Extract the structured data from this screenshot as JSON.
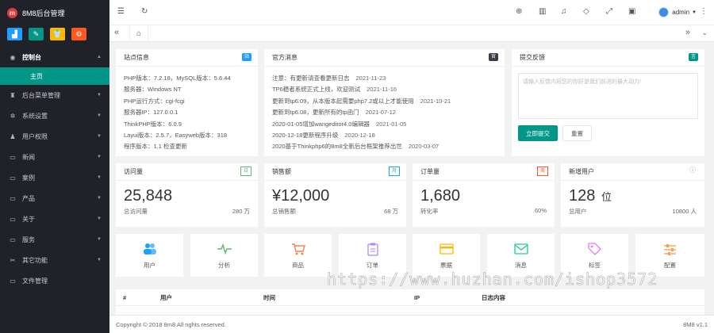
{
  "app": {
    "title": "8M8后台管理",
    "logo_letter": "m"
  },
  "quick_buttons": [
    {
      "icon": "chart-icon",
      "color": "#1e9fff",
      "glyph": "▟"
    },
    {
      "icon": "edit-icon",
      "color": "#009688",
      "glyph": "✎"
    },
    {
      "icon": "tshirt-icon",
      "color": "#ffb800",
      "glyph": "👕"
    },
    {
      "icon": "settings-icon",
      "color": "#ff5722",
      "glyph": "⚙"
    }
  ],
  "sidebar": {
    "items": [
      {
        "label": "控制台",
        "icon": "dashboard-icon",
        "glyph": "◉",
        "caret": "▲"
      },
      {
        "label": "后台菜单管理",
        "icon": "menu-icon",
        "glyph": "♜",
        "caret": "▼"
      },
      {
        "label": "系统设置",
        "icon": "gear-icon",
        "glyph": "✲",
        "caret": "▼"
      },
      {
        "label": "用户权限",
        "icon": "users-icon",
        "glyph": "♟",
        "caret": "▼"
      },
      {
        "label": "新闻",
        "icon": "monitor-icon",
        "glyph": "▭",
        "caret": "▼"
      },
      {
        "label": "案例",
        "icon": "monitor-icon",
        "glyph": "▭",
        "caret": "▼"
      },
      {
        "label": "产品",
        "icon": "monitor-icon",
        "glyph": "▭",
        "caret": "▼"
      },
      {
        "label": "关于",
        "icon": "monitor-icon",
        "glyph": "▭",
        "caret": "▼"
      },
      {
        "label": "服务",
        "icon": "monitor-icon",
        "glyph": "▭",
        "caret": "▼"
      },
      {
        "label": "其它功能",
        "icon": "wrench-icon",
        "glyph": "✂",
        "caret": "▼"
      },
      {
        "label": "文件管理",
        "icon": "monitor-icon",
        "glyph": "▭",
        "caret": ""
      }
    ],
    "active_sub": "主页"
  },
  "topbar": {
    "user": "admin",
    "icons": [
      "collapse-icon",
      "refresh-icon",
      "globe-icon",
      "trash-icon",
      "bell-icon",
      "tag-icon",
      "fullscreen-icon",
      "lock-icon",
      "more-icon"
    ]
  },
  "tabs": {
    "home_glyph": "⌂"
  },
  "site_info": {
    "title": "站点信息",
    "tag": "站",
    "tag_color": "#1e9fff",
    "lines": [
      "PHP版本：7.2.18，MySQL版本：5.6.44",
      "服务器：Windows NT",
      "PHP运行方式：cgi-fcgi",
      "服务器IP：127.0.0.1",
      "ThinkPHP版本：6.0.9",
      "Layui版本：2.5.7，Easyweb版本：318",
      "程序版本：1.1 检查更新"
    ]
  },
  "official_news": {
    "title": "官方消息",
    "tag": "官",
    "tag_color": "#393d49",
    "items": [
      {
        "text": "注意：有更新请查看更新日志",
        "date": "2021-11-23"
      },
      {
        "text": "TP6稳者系统正式上线，欢迎测试",
        "date": "2021-11-16"
      },
      {
        "text": "更新到tp6.09，从本版本起需要php7.2或以上才能使用",
        "date": "2021-10-21"
      },
      {
        "text": "更新到tp6.08，更新所有的tp函门",
        "date": "2021-07-12"
      },
      {
        "text": "2020-01-05增加wangeditor4.0编辑器",
        "date": "2021-01-05"
      },
      {
        "text": "2020-12-18更新程序升级",
        "date": "2020-12-18"
      },
      {
        "text": "2020基于Thinkphp6的8m8全新后台框架推荐出世",
        "date": "2020-03-07"
      }
    ]
  },
  "feedback": {
    "title": "提交反馈",
    "tag": "言",
    "tag_color": "#009688",
    "placeholder": "请输入反馈内容您的你好是我们前进的最大动力!",
    "submit_label": "立即提交",
    "reset_label": "重置"
  },
  "stats": [
    {
      "title": "访问量",
      "tag": "日",
      "tag_color": "#5fb878",
      "value": "25,848",
      "foot_label": "总访问量",
      "foot_value": "280 万"
    },
    {
      "title": "销售额",
      "tag": "月",
      "tag_color": "#1e9fff",
      "value": "¥12,000",
      "foot_label": "总销售额",
      "foot_value": "68 万"
    },
    {
      "title": "订单量",
      "tag": "周",
      "tag_color": "#ff5722",
      "value": "1,680",
      "foot_label": "转化率",
      "foot_value": "60%"
    },
    {
      "title": "新增用户",
      "tag": "ⓘ",
      "tag_color": "#999999",
      "value": "128",
      "value_unit": "位",
      "foot_label": "总用户",
      "foot_value": "10800 人"
    }
  ],
  "shortcuts": [
    {
      "label": "用户",
      "icon": "users-icon",
      "glyph": "👥",
      "color": "#1e9fff"
    },
    {
      "label": "分析",
      "icon": "pulse-icon",
      "glyph": "∿",
      "color": "#5fb878"
    },
    {
      "label": "商品",
      "icon": "cart-icon",
      "glyph": "🛒",
      "color": "#ff7f50"
    },
    {
      "label": "订单",
      "icon": "clipboard-icon",
      "glyph": "📋",
      "color": "#a78bfa"
    },
    {
      "label": "票据",
      "icon": "card-icon",
      "glyph": "▤",
      "color": "#ffb800"
    },
    {
      "label": "消息",
      "icon": "mail-icon",
      "glyph": "✉",
      "color": "#20c997"
    },
    {
      "label": "标签",
      "icon": "tag-icon",
      "glyph": "🏷",
      "color": "#e879f9"
    },
    {
      "label": "配置",
      "icon": "sliders-icon",
      "glyph": "☰",
      "color": "#ff9f43"
    }
  ],
  "log_table": {
    "columns": [
      "#",
      "用户",
      "时间",
      "IP",
      "日志内容"
    ]
  },
  "footer": {
    "copyright": "Copyright © 2018 8m8 All rights reserved.",
    "version": "8M8 v1.1"
  },
  "watermark": "https://www.huzhan.com/ishop3572"
}
